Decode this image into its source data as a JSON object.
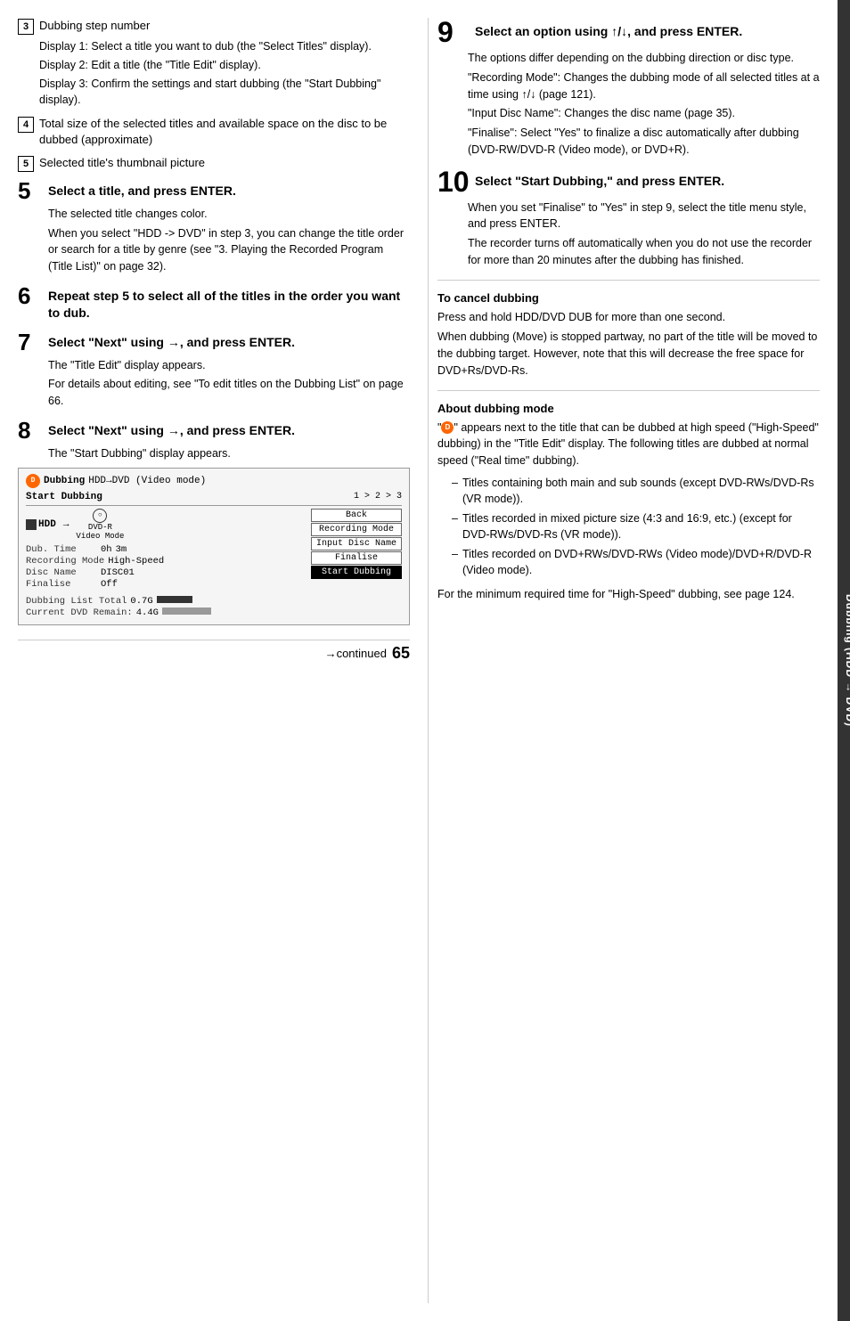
{
  "sidebar": {
    "label": "Dubbing (HDD → DVD)",
    "arrow": "→"
  },
  "items": [
    {
      "num": "3",
      "title": "Dubbing step number",
      "sub_items": [
        "Display 1: Select a title you want to dub (the \"Select Titles\" display).",
        "Display 2: Edit a title (the \"Title Edit\" display).",
        "Display 3: Confirm the settings and start dubbing (the \"Start Dubbing\" display)."
      ]
    },
    {
      "num": "4",
      "title": "Total size of the selected titles and available space on the disc to be dubbed (approximate)"
    },
    {
      "num": "5",
      "title": "Selected title's thumbnail picture"
    }
  ],
  "steps": [
    {
      "num": "5",
      "title": "Select a title, and press ENTER.",
      "body": [
        "The selected title changes color.",
        "When you select \"HDD -> DVD\" in step 3, you can change the title order or search for a title by genre (see \"3. Playing the Recorded Program (Title List)\" on page 32)."
      ]
    },
    {
      "num": "6",
      "title": "Repeat step 5 to select all of the titles in the order you want to dub."
    },
    {
      "num": "7",
      "title": "Select \"Next\" using →, and press ENTER.",
      "body": [
        "The \"Title Edit\" display appears.",
        "For details about editing, see \"To edit titles on the Dubbing List\" on page 66."
      ]
    },
    {
      "num": "8",
      "title": "Select \"Next\" using →, and press ENTER.",
      "body": [
        "The \"Start Dubbing\" display appears."
      ]
    }
  ],
  "screenshot": {
    "header_label": "Dubbing",
    "header_mode": "HDD→DVD (Video mode)",
    "header_step": "Start Dubbing",
    "step_indicator": "1 > 2 > 3",
    "hdd_label": "HDD",
    "arrow": "→",
    "dvdr_label": "DVD-R",
    "dvdr_sub": "Video Mode",
    "dub_time_label": "Dub. Time",
    "dub_time_val": "0h",
    "dub_time_val2": "3m",
    "recording_mode_label": "Recording Mode",
    "recording_mode_val": "High-Speed",
    "disc_name_label": "Disc Name",
    "disc_name_val": "DISC01",
    "finalise_label": "Finalise",
    "finalise_val": "Off",
    "dubbing_list_label": "Dubbing List Total",
    "dubbing_list_val": "0.7G",
    "current_dvd_label": "Current DVD Remain:",
    "current_dvd_val": "4.4G",
    "buttons": [
      "Back",
      "Recording Mode",
      "Input Disc Name",
      "Finalise",
      "Start Dubbing"
    ]
  },
  "right_steps": [
    {
      "num": "9",
      "title": "Select an option using ↑/↓, and press ENTER.",
      "body": [
        "The options differ depending on the dubbing direction or disc type.",
        "\"Recording Mode\": Changes the dubbing mode of all selected titles at a time using ↑/↓ (page 121).",
        "\"Input Disc Name\": Changes the disc name (page 35).",
        "\"Finalise\": Select \"Yes\" to finalize a disc automatically after dubbing (DVD-RW/DVD-R (Video mode), or DVD+R)."
      ]
    },
    {
      "num": "10",
      "title": "Select \"Start Dubbing,\" and press ENTER.",
      "body": [
        "When you set \"Finalise\" to \"Yes\" in step 9, select the title menu style, and press ENTER.",
        "The recorder turns off automatically when you do not use the recorder for more than 20 minutes after the dubbing has finished."
      ]
    }
  ],
  "cancel_section": {
    "heading": "To cancel dubbing",
    "body": [
      "Press and hold HDD/DVD DUB for more than one second.",
      "When dubbing (Move) is stopped partway, no part of the title will be moved to the dubbing target. However, note that this will decrease the free space for DVD+Rs/DVD-Rs."
    ]
  },
  "about_section": {
    "heading": "About dubbing mode",
    "intro": "\" \" appears next to the title that can be dubbed at high speed (\"High-Speed\" dubbing) in the \"Title Edit\" display. The following titles are dubbed at normal speed (\"Real time\" dubbing).",
    "bullets": [
      "Titles containing both main and sub sounds (except DVD-RWs/DVD-Rs (VR mode)).",
      "Titles recorded in mixed picture size (4:3 and 16:9, etc.) (except for DVD-RWs/DVD-Rs (VR mode)).",
      "Titles recorded on DVD+RWs/DVD-RWs (Video mode)/DVD+R/DVD-R (Video mode)."
    ],
    "footer": "For the minimum required time for \"High-Speed\" dubbing, see page 124."
  },
  "footer": {
    "continued": "→continued",
    "page_num": "65"
  }
}
